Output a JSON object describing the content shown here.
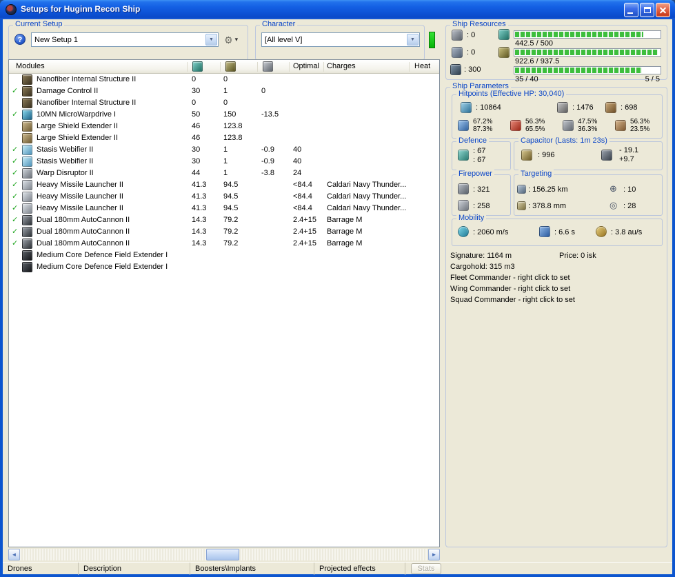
{
  "window": {
    "title": "Setups for Huginn Recon Ship"
  },
  "icons": {
    "check": "✓",
    "combo_arrow": "▼",
    "tools": "⚙",
    "tools_drop": "▾",
    "help": "?",
    "scroll_left": "◄",
    "scroll_right": "►",
    "max_targets": "⊕",
    "sensor": "◎"
  },
  "setup": {
    "group_label": "Current Setup",
    "value": "New Setup 1"
  },
  "character": {
    "group_label": "Character",
    "value": "[All level V]"
  },
  "modules": {
    "headers": {
      "name": "Modules",
      "optimal": "Optimal",
      "charges": "Charges",
      "heat": "Heat"
    },
    "rows": [
      {
        "active": false,
        "icon": "structure",
        "name": "Nanofiber Internal Structure II",
        "cpu": "0",
        "pg": "0",
        "cap": "",
        "optimal": "",
        "charges": ""
      },
      {
        "active": true,
        "icon": "structure",
        "name": "Damage Control II",
        "cpu": "30",
        "pg": "1",
        "cap": "0",
        "optimal": "",
        "charges": ""
      },
      {
        "active": false,
        "icon": "structure",
        "name": "Nanofiber Internal Structure II",
        "cpu": "0",
        "pg": "0",
        "cap": "",
        "optimal": "",
        "charges": ""
      },
      {
        "active": true,
        "icon": "propulsion",
        "name": "10MN MicroWarpdrive I",
        "cpu": "50",
        "pg": "150",
        "cap": "-13.5",
        "optimal": "",
        "charges": ""
      },
      {
        "active": false,
        "icon": "shield",
        "name": "Large Shield Extender II",
        "cpu": "46",
        "pg": "123.8",
        "cap": "",
        "optimal": "",
        "charges": ""
      },
      {
        "active": false,
        "icon": "shield",
        "name": "Large Shield Extender II",
        "cpu": "46",
        "pg": "123.8",
        "cap": "",
        "optimal": "",
        "charges": ""
      },
      {
        "active": true,
        "icon": "web",
        "name": "Stasis Webifier II",
        "cpu": "30",
        "pg": "1",
        "cap": "-0.9",
        "optimal": "40",
        "charges": ""
      },
      {
        "active": true,
        "icon": "web",
        "name": "Stasis Webifier II",
        "cpu": "30",
        "pg": "1",
        "cap": "-0.9",
        "optimal": "40",
        "charges": ""
      },
      {
        "active": true,
        "icon": "disruptor",
        "name": "Warp Disruptor II",
        "cpu": "44",
        "pg": "1",
        "cap": "-3.8",
        "optimal": "24",
        "charges": ""
      },
      {
        "active": true,
        "icon": "launcher",
        "name": "Heavy Missile Launcher II",
        "cpu": "41.3",
        "pg": "94.5",
        "cap": "",
        "optimal": "<84.4",
        "charges": "Caldari Navy Thunder..."
      },
      {
        "active": true,
        "icon": "launcher",
        "name": "Heavy Missile Launcher II",
        "cpu": "41.3",
        "pg": "94.5",
        "cap": "",
        "optimal": "<84.4",
        "charges": "Caldari Navy Thunder..."
      },
      {
        "active": true,
        "icon": "launcher",
        "name": "Heavy Missile Launcher II",
        "cpu": "41.3",
        "pg": "94.5",
        "cap": "",
        "optimal": "<84.4",
        "charges": "Caldari Navy Thunder..."
      },
      {
        "active": true,
        "icon": "autocannon",
        "name": "Dual 180mm AutoCannon II",
        "cpu": "14.3",
        "pg": "79.2",
        "cap": "",
        "optimal": "2.4+15",
        "charges": "Barrage M"
      },
      {
        "active": true,
        "icon": "autocannon",
        "name": "Dual 180mm AutoCannon II",
        "cpu": "14.3",
        "pg": "79.2",
        "cap": "",
        "optimal": "2.4+15",
        "charges": "Barrage M"
      },
      {
        "active": true,
        "icon": "autocannon",
        "name": "Dual 180mm AutoCannon II",
        "cpu": "14.3",
        "pg": "79.2",
        "cap": "",
        "optimal": "2.4+15",
        "charges": "Barrage M"
      },
      {
        "active": false,
        "icon": "rig",
        "name": "Medium Core Defence Field Extender I",
        "cpu": "",
        "pg": "",
        "cap": "",
        "optimal": "",
        "charges": ""
      },
      {
        "active": false,
        "icon": "rig",
        "name": "Medium Core Defence Field Extender I",
        "cpu": "",
        "pg": "",
        "cap": "",
        "optimal": "",
        "charges": ""
      }
    ]
  },
  "ship_resources": {
    "title": "Ship Resources",
    "turret_slots": ": 0",
    "launcher_slots": ": 0",
    "calibration": ": 300",
    "bars": [
      {
        "label": "442.5 / 500",
        "pct": 88.5
      },
      {
        "label": "922.6 / 937.5",
        "pct": 98.4
      },
      {
        "label": "35 / 40",
        "pct": 87.5,
        "extra": "5 / 5"
      }
    ]
  },
  "parameters": {
    "title": "Ship Parameters",
    "hitpoints": {
      "title": "Hitpoints (Effective HP: 30,040)",
      "shield": ": 10864",
      "armor": ": 1476",
      "hull": ": 698",
      "resists": [
        {
          "top": "67.2%",
          "bottom": "87.3%"
        },
        {
          "top": "56.3%",
          "bottom": "65.5%"
        },
        {
          "top": "47.5%",
          "bottom": "36.3%"
        },
        {
          "top": "56.3%",
          "bottom": "23.5%"
        }
      ]
    },
    "defence": {
      "title": "Defence",
      "top": ": 67",
      "bottom": ": 67"
    },
    "capacitor": {
      "title": "Capacitor (Lasts: 1m 23s)",
      "amount": ": 996",
      "usage": "- 19.1",
      "recharge": "+9.7"
    },
    "firepower": {
      "title": "Firepower",
      "volley": ": 321",
      "dps": ": 258"
    },
    "targeting": {
      "title": "Targeting",
      "range": ": 156.25 km",
      "max_targets": ": 10",
      "scan_resolution": ": 378.8 mm",
      "sensor_strength": ": 28"
    },
    "mobility": {
      "title": "Mobility",
      "speed": ": 2060 m/s",
      "agility": ": 6.6 s",
      "warp_speed": ": 3.8 au/s"
    },
    "info": {
      "signature": "Signature: 1164 m",
      "price": "Price: 0 isk",
      "cargohold": "Cargohold: 315 m3",
      "fleet_commander": "Fleet Commander - right click to set",
      "wing_commander": "Wing Commander - right click to set",
      "squad_commander": "Squad Commander - right click to set"
    }
  },
  "bottom_bar": {
    "tabs": [
      "Drones",
      "Description",
      "Boosters\\Implants",
      "Projected effects"
    ],
    "stats_button": "Stats"
  }
}
